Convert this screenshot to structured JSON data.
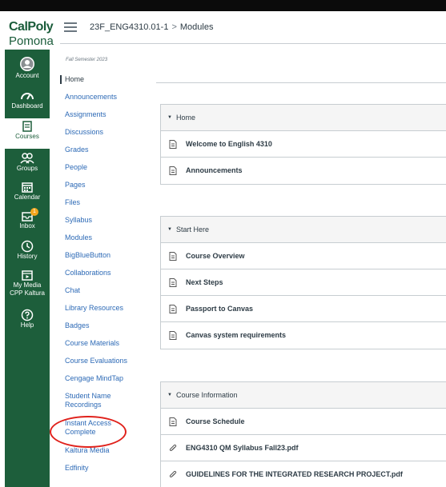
{
  "logo": {
    "line1": "CalPoly",
    "line2": "Pomona"
  },
  "global_nav": [
    {
      "label": "Account",
      "icon": "account-icon"
    },
    {
      "label": "Dashboard",
      "icon": "dashboard-icon"
    },
    {
      "label": "Courses",
      "icon": "courses-icon"
    },
    {
      "label": "Groups",
      "icon": "groups-icon"
    },
    {
      "label": "Calendar",
      "icon": "calendar-icon"
    },
    {
      "label": "Inbox",
      "icon": "inbox-icon",
      "badge": "1"
    },
    {
      "label": "History",
      "icon": "history-icon"
    },
    {
      "label": "My Media\nCPP Kaltura",
      "label_line1": "My Media",
      "label_line2": "CPP Kaltura",
      "icon": "my-media-icon"
    },
    {
      "label": "Help",
      "icon": "help-icon"
    }
  ],
  "breadcrumb": {
    "course": "23F_ENG4310.01-1",
    "separator": ">",
    "page": "Modules"
  },
  "course_nav": {
    "term": "Fall Semester 2023",
    "items": [
      "Home",
      "Announcements",
      "Assignments",
      "Discussions",
      "Grades",
      "People",
      "Pages",
      "Files",
      "Syllabus",
      "Modules",
      "BigBlueButton",
      "Collaborations",
      "Chat",
      "Library Resources",
      "Badges",
      "Course Materials",
      "Course Evaluations",
      "Cengage MindTap",
      "Student Name Recordings",
      "Instant Access Complete",
      "Kaltura Media",
      "Edfinity"
    ]
  },
  "modules": [
    {
      "title": "Home",
      "items": [
        "Welcome to English 4310",
        "Announcements"
      ]
    },
    {
      "title": "Start Here",
      "items": [
        "Course Overview",
        "Next Steps",
        "Passport to Canvas",
        "Canvas system requirements"
      ]
    },
    {
      "title": "Course Information",
      "items": [
        "Course Schedule",
        "ENG4310 QM Syllabus Fall23.pdf",
        "GUIDELINES FOR THE INTEGRATED RESEARCH PROJECT.pdf"
      ]
    }
  ],
  "colors": {
    "nav_green": "#1d5e3b",
    "link_blue": "#2d6ab6",
    "highlight_red": "#e0211b",
    "badge_orange": "#f3a61c"
  }
}
